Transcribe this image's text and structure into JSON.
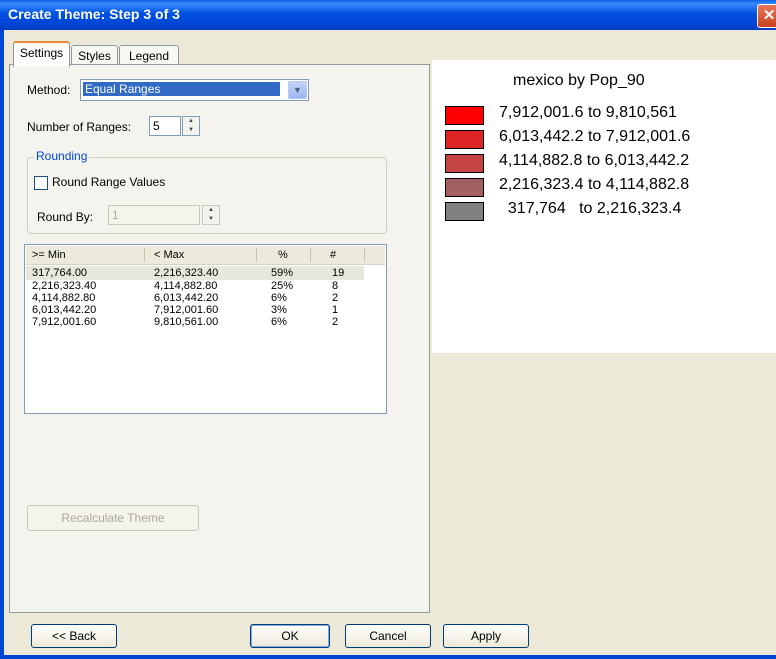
{
  "window": {
    "title": "Create Theme: Step 3 of 3",
    "close_glyph": "✕"
  },
  "tabs": [
    {
      "label": "Settings",
      "active": true
    },
    {
      "label": "Styles",
      "active": false
    },
    {
      "label": "Legend",
      "active": false
    }
  ],
  "settings": {
    "method_label": "Method:",
    "method_value": "Equal Ranges",
    "ranges_label": "Number of Ranges:",
    "ranges_value": "5",
    "rounding_group": "Rounding",
    "round_values_label": "Round Range Values",
    "round_values_checked": false,
    "round_by_label": "Round By:",
    "round_by_value": "1"
  },
  "ranges_table": {
    "columns": [
      ">= Min",
      "< Max",
      "%",
      "#"
    ],
    "rows": [
      [
        "317,764.00",
        "2,216,323.40",
        "59%",
        "19"
      ],
      [
        "2,216,323.40",
        "4,114,882.80",
        "25%",
        "8"
      ],
      [
        "4,114,882.80",
        "6,013,442.20",
        "6%",
        "2"
      ],
      [
        "6,013,442.20",
        "7,912,001.60",
        "3%",
        "1"
      ],
      [
        "7,912,001.60",
        "9,810,561.00",
        "6%",
        "2"
      ]
    ],
    "selected_row": 0
  },
  "recalculate_label": "Recalculate Theme",
  "footer": {
    "back_label": "<< Back",
    "ok_label": "OK",
    "cancel_label": "Cancel",
    "apply_label": "Apply"
  },
  "legend_preview": {
    "title": "mexico by Pop_90",
    "entries": [
      {
        "label": "7,912,001.6 to 9,810,561",
        "color": "#ff0000"
      },
      {
        "label": "6,013,442.2 to 7,912,001.6",
        "color": "#dd2525"
      },
      {
        "label": "4,114,882.8 to 6,013,442.2",
        "color": "#c44444"
      },
      {
        "label": "2,216,323.4 to 4,114,882.8",
        "color": "#a26060"
      },
      {
        "label": "  317,764   to 2,216,323.4",
        "color": "#808080"
      }
    ]
  }
}
